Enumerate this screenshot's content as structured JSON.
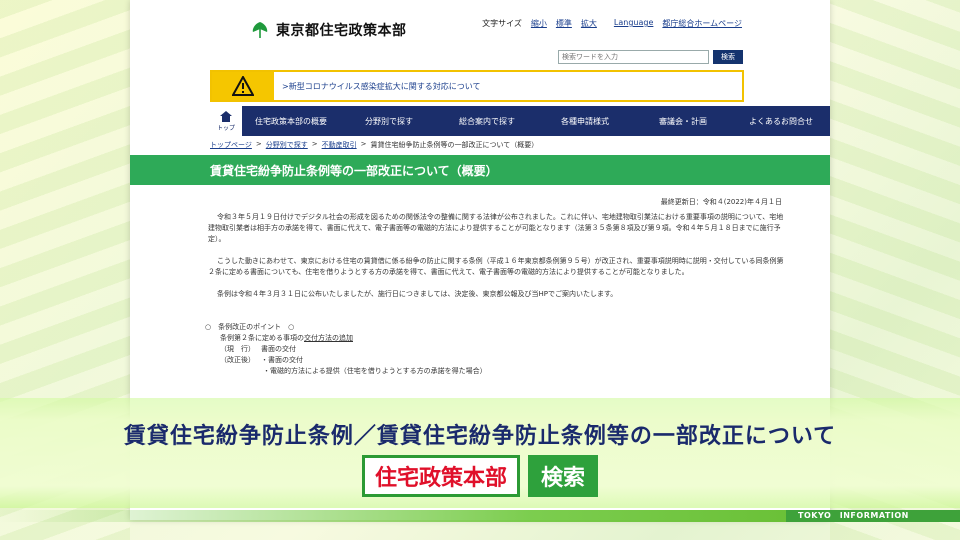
{
  "header": {
    "site_name": "東京都住宅政策本部",
    "text_size_label": "文字サイズ",
    "size_small": "縮小",
    "size_standard": "標準",
    "size_large": "拡大",
    "language": "Language",
    "tocho_home": "都庁総合ホームページ",
    "search_placeholder": "検索ワードを入力",
    "search_button": "検索"
  },
  "alert": {
    "text": ">新型コロナウイルス感染症拡大に関する対応について"
  },
  "nav": {
    "home": "トップ",
    "items": [
      "住宅政策本部の概要",
      "分野別で探す",
      "総合案内で探す",
      "各種申請様式",
      "審議会・計画",
      "よくあるお問合せ"
    ]
  },
  "breadcrumb": {
    "top": "トップページ",
    "sep": ">",
    "category": "分野別で探す",
    "subcategory": "不動産取引",
    "current": "賃貸住宅紛争防止条例等の一部改正について（概要）"
  },
  "page": {
    "title": "賃貸住宅紛争防止条例等の一部改正について（概要）",
    "updated": "最終更新日：令和４(2022)年４月１日",
    "paragraphs": [
      "令和３年５月１９日付けでデジタル社会の形成を図るための関係法令の整備に関する法律が公布されました。これに伴い、宅地建物取引業法における重要事項の説明について、宅地建物取引業者は相手方の承諾を得て、書面に代えて、電子書面等の電磁的方法により提供することが可能となります（法第３５条第８項及び第９項。令和４年５月１８日までに施行予定）。",
      "こうした動きにあわせて、東京における住宅の賃貸借に係る紛争の防止に関する条例（平成１６年東京都条例第９５号）が改正され、重要事項説明時に説明・交付している同条例第２条に定める書面についても、住宅を借りようとする方の承諾を得て、書面に代えて、電子書面等の電磁的方法により提供することが可能となりました。",
      "条例は令和４年３月３１日に公布いたしましたが、施行日につきましては、決定後、東京都公報及び当HPでご案内いたします。"
    ],
    "points_heading": "○　条例改正のポイント　○",
    "points_line": "条例第２条に定める事項の",
    "points_underline": "交付方法の追加",
    "current_label": "（現　行）",
    "current_value": "書面の交付",
    "revised_label": "（改正後）",
    "revised_value": "・書面の交付",
    "revised_value2": "・電磁的方法による提供（住宅を借りようとする方の承諾を得た場合）"
  },
  "overlay": {
    "caption": "賃貸住宅紛争防止条例／賃貸住宅紛争防止条例等の一部改正について",
    "search_keyword": "住宅政策本部",
    "search_label": "検索",
    "ticker": "TOKYO　INFORMATION"
  },
  "colors": {
    "nav": "#1b2e6b",
    "title_band": "#2eaa58",
    "alert_border": "#f2c200",
    "caption_text": "#1a2a6c",
    "keyword_red": "#e0102a",
    "search_green": "#2ea13c"
  }
}
